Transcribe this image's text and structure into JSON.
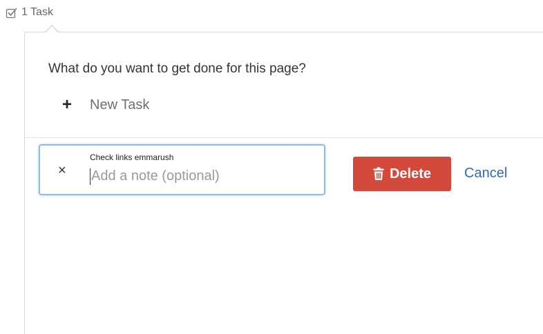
{
  "header": {
    "task_count_label": "1 Task",
    "icon": "checkbox-icon"
  },
  "panel": {
    "question": "What do you want to get done for this page?",
    "new_task": {
      "icon": "plus-icon",
      "label": "New Task"
    }
  },
  "task_editor": {
    "close_glyph": "×",
    "task_title": "Check links emmarush",
    "note_value": "",
    "note_placeholder": "Add a note (optional)"
  },
  "actions": {
    "delete_label": "Delete",
    "delete_icon": "trash-icon",
    "cancel_label": "Cancel"
  },
  "colors": {
    "delete_bg": "#d34a3d",
    "focus_border": "#8fbbea",
    "link": "#2f6bb0"
  }
}
